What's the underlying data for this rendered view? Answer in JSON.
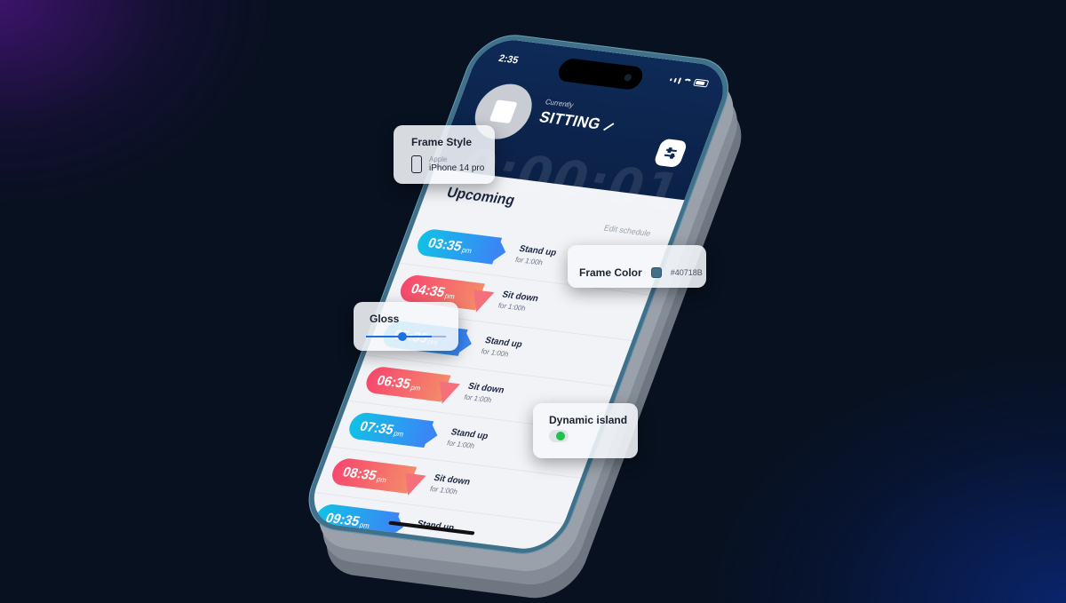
{
  "app": {
    "status_time": "2:35",
    "currently_label": "Currently",
    "state": "SITTING",
    "timer": "0:00:01",
    "upcoming_title": "Upcoming",
    "edit_schedule": "Edit schedule"
  },
  "schedule": [
    {
      "time": "03:35",
      "ampm": "pm",
      "action": "Stand up",
      "duration": "for 1:00h",
      "kind": "up"
    },
    {
      "time": "04:35",
      "ampm": "pm",
      "action": "Sit down",
      "duration": "for 1:00h",
      "kind": "down"
    },
    {
      "time": "05:35",
      "ampm": "pm",
      "action": "Stand up",
      "duration": "for 1:00h",
      "kind": "up"
    },
    {
      "time": "06:35",
      "ampm": "pm",
      "action": "Sit down",
      "duration": "for 1:00h",
      "kind": "down"
    },
    {
      "time": "07:35",
      "ampm": "pm",
      "action": "Stand up",
      "duration": "for 1:00h",
      "kind": "up"
    },
    {
      "time": "08:35",
      "ampm": "pm",
      "action": "Sit down",
      "duration": "for 1:00h",
      "kind": "down"
    },
    {
      "time": "09:35",
      "ampm": "pm",
      "action": "Stand up",
      "duration": "",
      "kind": "up"
    }
  ],
  "cards": {
    "frame_style": {
      "title": "Frame Style",
      "brand": "Apple",
      "model": "iPhone 14 pro"
    },
    "frame_color": {
      "title": "Frame Color",
      "hex": "#40718B",
      "color": "#40718b"
    },
    "gloss": {
      "title": "Gloss",
      "level": 0.55
    },
    "dynamic_island": {
      "title": "Dynamic island",
      "enabled": true
    }
  },
  "colors": {
    "header": "#0e2a57",
    "stand_up": "#11c1e6",
    "sit_down": "#f7476e",
    "toggle_on": "#1fc24a"
  },
  "icons": [
    "stop-icon",
    "pencil-icon",
    "settings-sliders-icon",
    "phone-outline-icon",
    "wifi-icon",
    "battery-icon"
  ]
}
